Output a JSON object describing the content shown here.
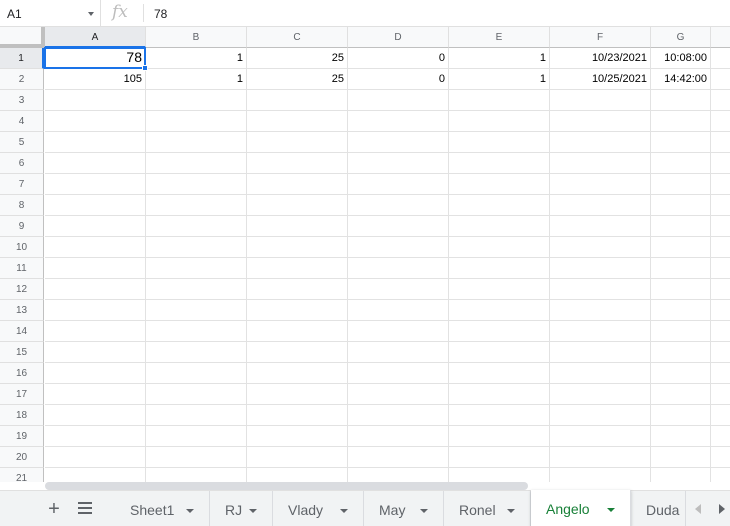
{
  "formula_bar": {
    "cell_ref": "A1",
    "fx_label": "fx",
    "formula": "78"
  },
  "columns": [
    "A",
    "B",
    "C",
    "D",
    "E",
    "F",
    "G"
  ],
  "rows": [
    "1",
    "2",
    "3",
    "4",
    "5",
    "6",
    "7",
    "8",
    "9",
    "10",
    "11",
    "12",
    "13",
    "14",
    "15",
    "16",
    "17",
    "18",
    "19",
    "20",
    "21"
  ],
  "cells": [
    [
      "78",
      "1",
      "25",
      "0",
      "1",
      "10/23/2021",
      "10:08:00"
    ],
    [
      "105",
      "1",
      "25",
      "0",
      "1",
      "10/25/2021",
      "14:42:00"
    ]
  ],
  "selected_cell": "A1",
  "sheet_tabs": [
    {
      "label": "Sheet1",
      "active": false
    },
    {
      "label": "RJ",
      "active": false
    },
    {
      "label": "Vlady",
      "active": false
    },
    {
      "label": "May",
      "active": false
    },
    {
      "label": "Ronel",
      "active": false
    },
    {
      "label": "Angelo",
      "active": true
    },
    {
      "label": "Duda",
      "active": false
    }
  ],
  "colors": {
    "selection": "#1a73e8",
    "active_tab": "#188038",
    "header_bg": "#f8f9fa",
    "gridline": "#e2e2e2"
  },
  "icons": {
    "add_sheet": "plus-icon",
    "all_sheets": "menu-icon",
    "scroll_left": "triangle-left-icon",
    "scroll_right": "triangle-right-icon"
  }
}
